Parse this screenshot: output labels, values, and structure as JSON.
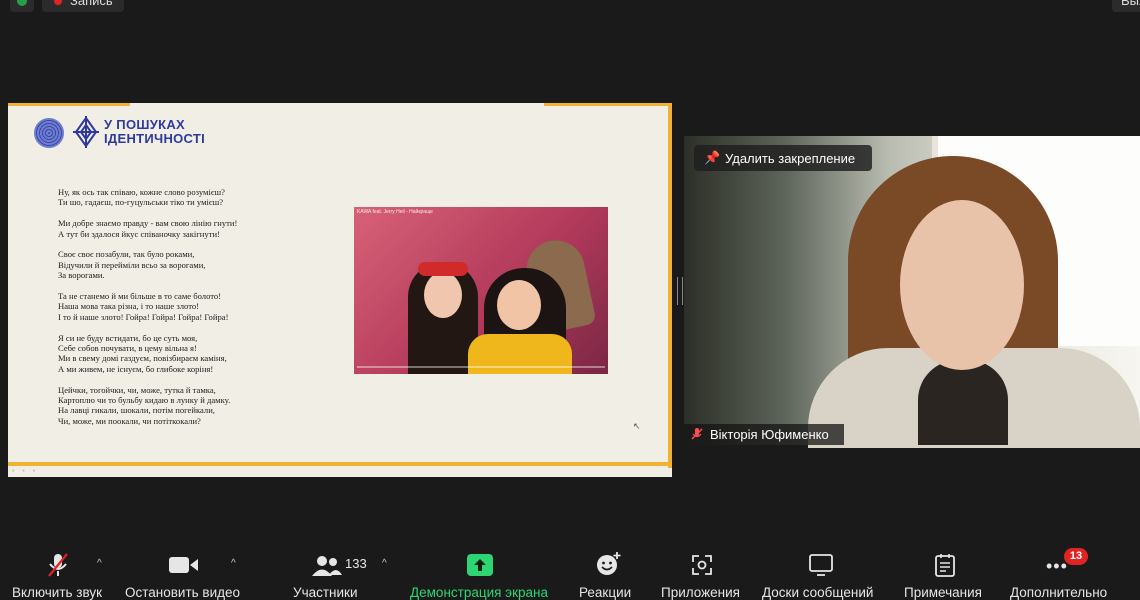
{
  "top_bar": {
    "recording_label": "Запись",
    "exit_label": "Выход"
  },
  "share": {
    "logo_line1": "У ПОШУКАХ",
    "logo_line2": "ІДЕНТИЧНОСТІ",
    "video_title": "KAWA feat. Jerry Heil - Найкраще",
    "poem": [
      "Ну, як ось так співаю, кожне слово розумієш?\nТи шо, гадаєш, по-гуцульськи тіко ти умієш?",
      "Ми добре знаємо правду - вам свою лінію гнути!\nА тут би здалося йкус співаночку закігнути!",
      "Своє своє позабули, так було роками,\nВідучили й перейміли всьо за ворогами,\nЗа ворогами.",
      "Та не станемо й ми більше в то саме болото!\nНаша мова така різна, і то наше злото!\nІ то й наше злото! Гойра! Гойра! Гойра! Гойра!",
      "Я си не буду встидати, бо це суть моя,\nСебе собов почувати, в цему вільна я!\nМи в свему домі газдуєм, повізбираєм каміня,\nА ми живем, не існуєм, бо глибоке коріня!",
      "Цейчки, тогойчки, чи, може, тутка й тамка,\nКартоплю чи то бульбу кидаю в лунку й дамку.\nНа лавці гикали, шокали, потім погейкали,\nЧи, може, ми поокали, чи потіткокали?"
    ]
  },
  "camera": {
    "unpin_label": "Удалить закрепление",
    "participant_name": "Вікторія Юфименко"
  },
  "toolbar": {
    "mute_label": "Включить звук",
    "video_label": "Остановить видео",
    "participants_label": "Участники",
    "participants_count": "133",
    "share_label": "Демонстрация экрана",
    "reactions_label": "Реакции",
    "apps_label": "Приложения",
    "whiteboards_label": "Доски сообщений",
    "notes_label": "Примечания",
    "more_label": "Дополнительно",
    "more_badge": "13"
  },
  "colors": {
    "accent_orange": "#f2b233",
    "share_green": "#2ed573",
    "badge_red": "#e02424"
  }
}
